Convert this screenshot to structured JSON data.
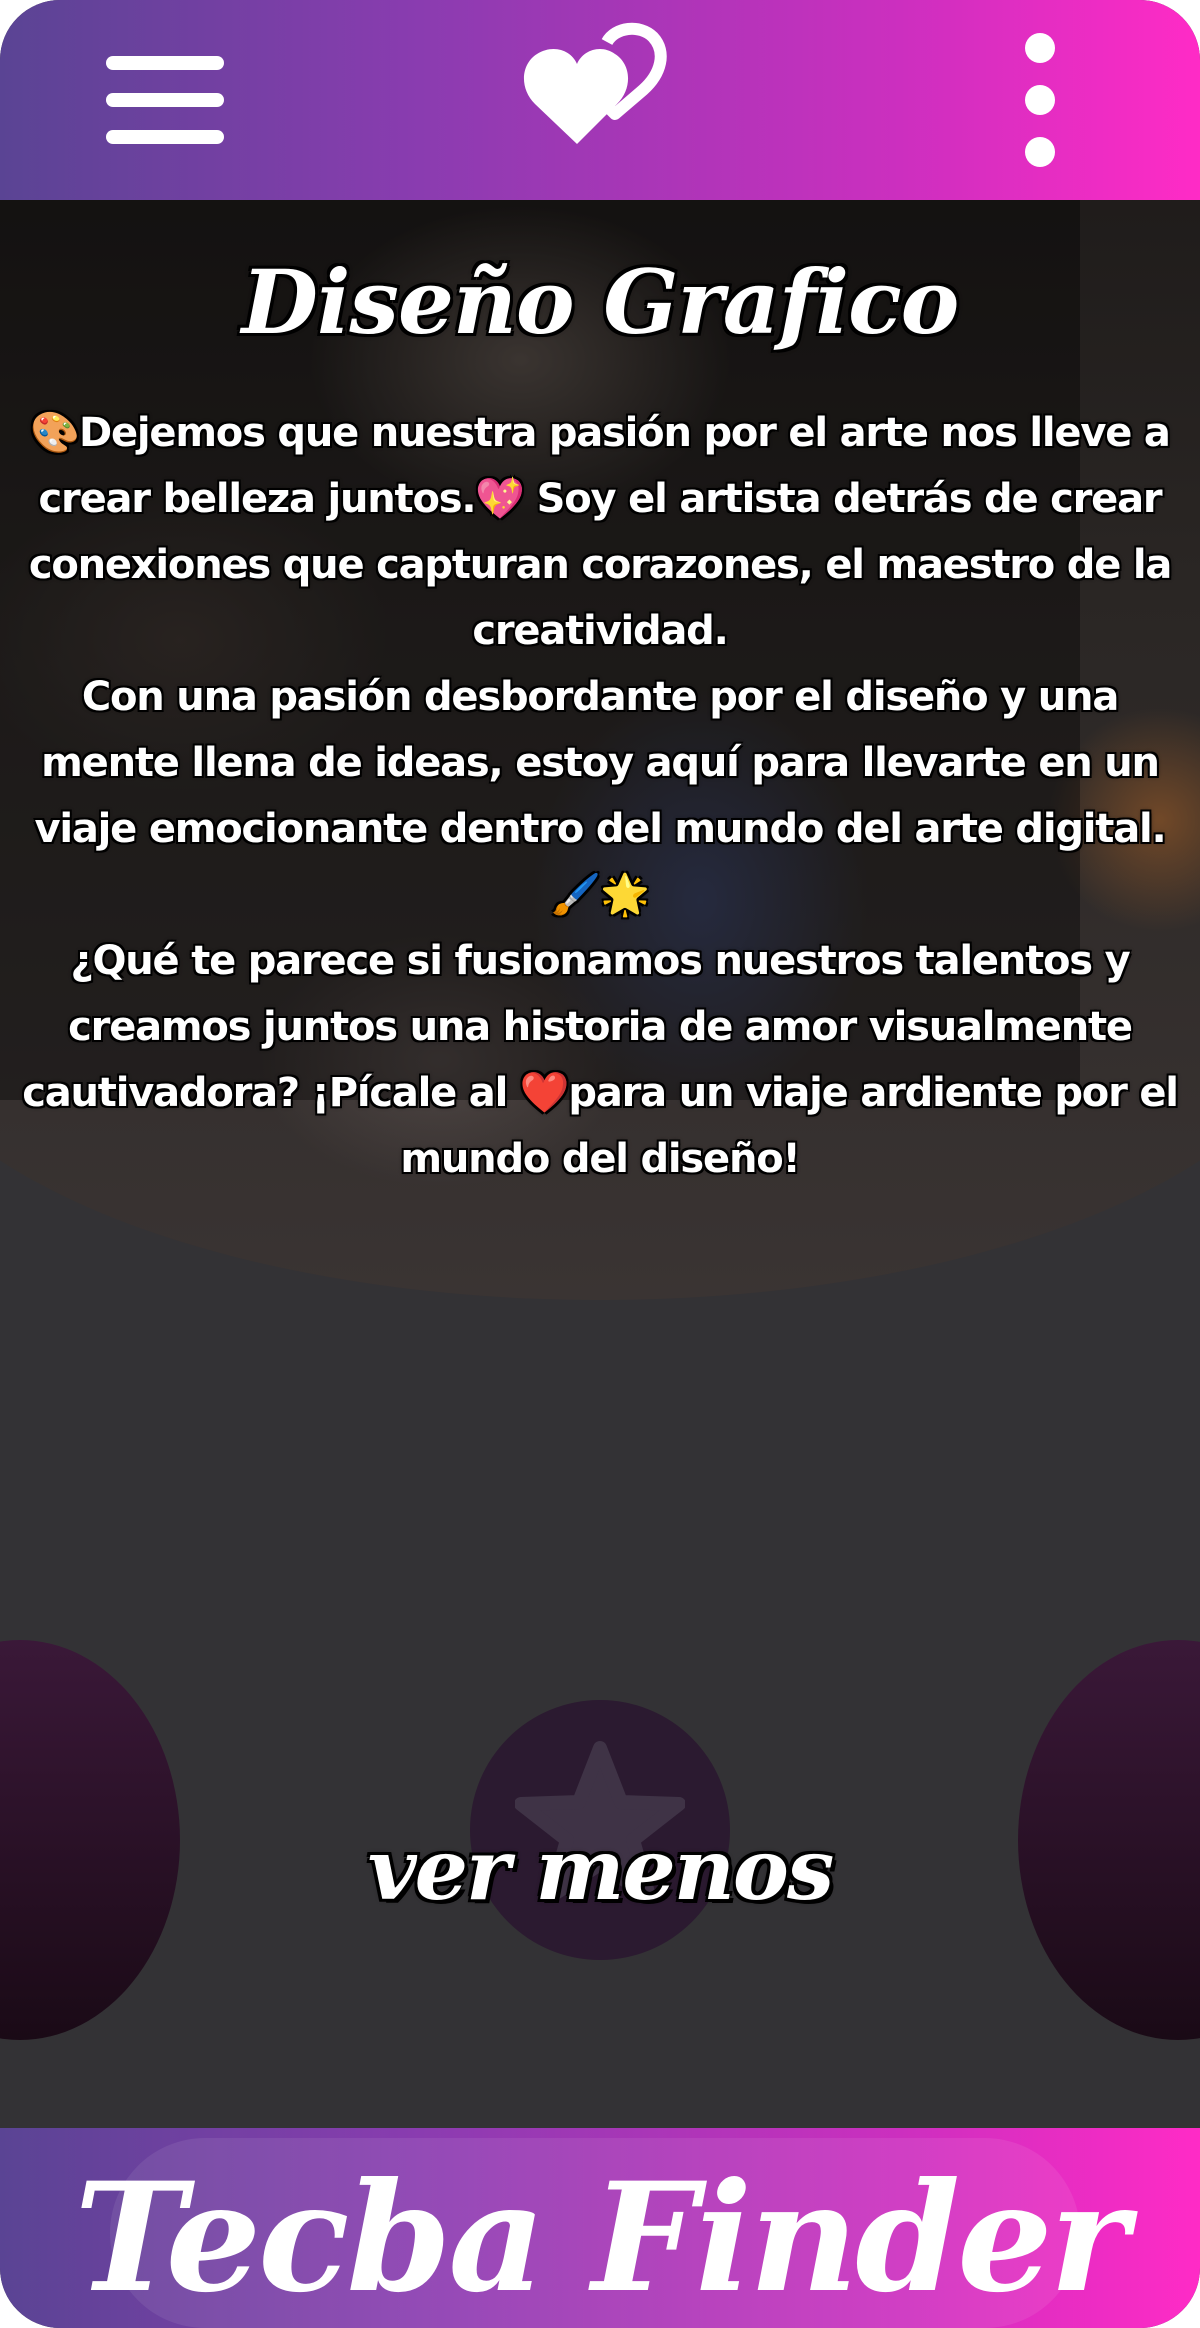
{
  "header": {
    "menu_icon": "hamburger-menu-icon",
    "logo_icon": "two-hearts-logo-icon",
    "more_icon": "vertical-dots-icon"
  },
  "profile": {
    "title": "Diseño Grafico",
    "description_lines": [
      "🎨Dejemos que nuestra pasión por el arte nos lleve a",
      "crear belleza juntos.💖 Soy el artista detrás de crear",
      "conexiones que capturan corazones, el maestro de la",
      "creatividad.",
      "Con una pasión desbordante por el diseño y una",
      "mente llena de ideas, estoy aquí para llevarte en un",
      "viaje emocionante dentro del mundo del arte digital.",
      "🖌️🌟",
      "¿Qué te parece si fusionamos nuestros talentos y",
      "creamos juntos una historia de amor visualmente",
      "cautivadora? ¡Pícale al ❤️para un viaje ardiente por el",
      "mundo del diseño!"
    ],
    "toggle_label": "ver menos",
    "star_icon": "star-icon"
  },
  "footer": {
    "brand": "Tecba Finder"
  },
  "colors": {
    "gradient_start": "#5a4494",
    "gradient_end": "#ff2bc6",
    "background": "#333235"
  }
}
